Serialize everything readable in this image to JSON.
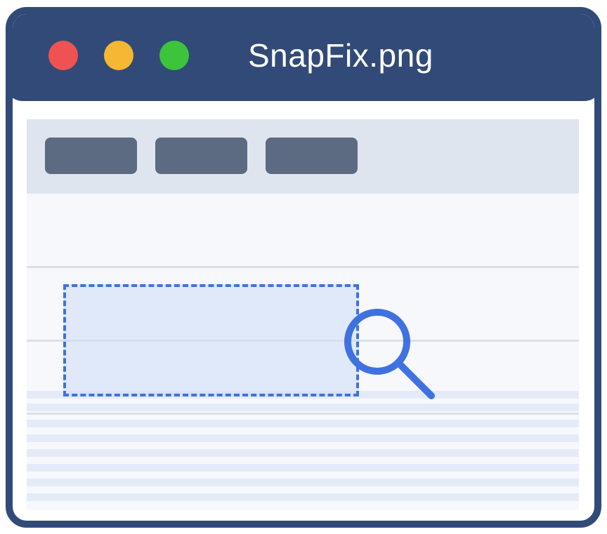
{
  "window": {
    "title": "SnapFix.png",
    "traffic_lights": {
      "close_color": "#f05252",
      "minimize_color": "#f6b733",
      "maximize_color": "#3cc43c"
    },
    "frame_color": "#324a77"
  },
  "toolbar": {
    "button_count": 3,
    "button_color": "#5c6b82",
    "background_color": "#dfe5ee"
  },
  "selection": {
    "style": "dashed",
    "border_color": "#3f72e0"
  },
  "icons": {
    "magnifier": "magnifying-glass-icon"
  }
}
